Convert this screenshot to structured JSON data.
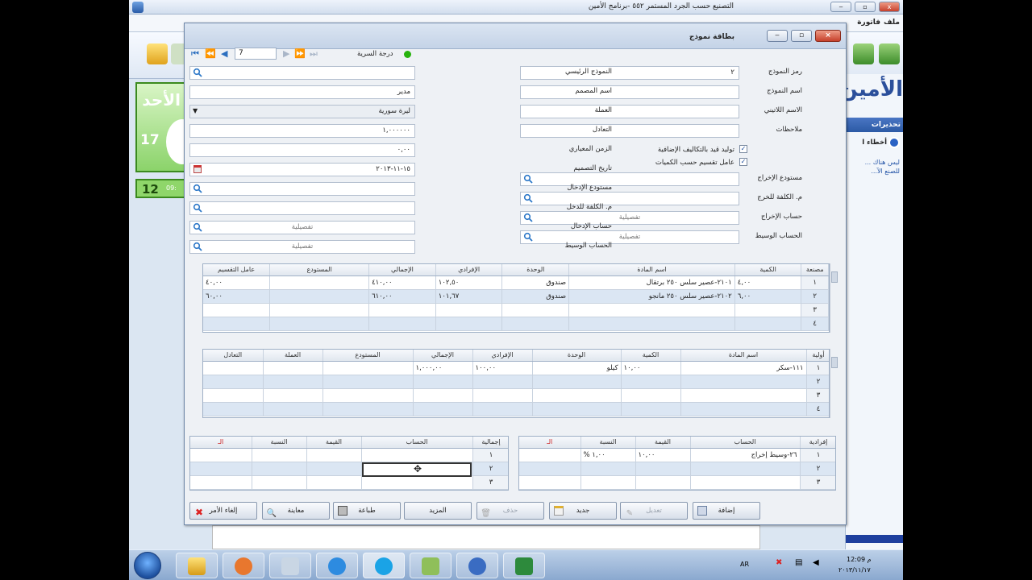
{
  "app": {
    "title": "التصنيع حسب الجرد المستمر ٥٥٢ -برنامج الأمين",
    "menu": [
      "ملف",
      "فاتورة"
    ]
  },
  "left_panel": {
    "day_label": "الأحد",
    "day_number": "17",
    "time_number": "12",
    "time_small": "09:"
  },
  "right_panel": {
    "logo": "الأمين",
    "header": "تحذيرات",
    "item": "أخطاء ا",
    "link_text": "ليس هناك ... للصنع الآ..."
  },
  "dialog": {
    "title": "بطاقة نموذج",
    "nav": {
      "record": "7"
    },
    "status_label": "درجة السرية",
    "fields": {
      "model_code_label": "رمز النموذج",
      "model_code": "٢",
      "model_name_label": "اسم النموذج",
      "model_name": "",
      "second_name_label": "الاسم اللاتيني",
      "second_name": "",
      "notes_label": "ملاحظات",
      "notes": "",
      "main_model_label": "النموذج الرئيسي",
      "main_model": "",
      "designer_label": "اسم المصمم",
      "designer": "مدير",
      "currency_label": "العملة",
      "currency": "ليرة سورية",
      "rate_label": "التعادل",
      "rate": "١,٠٠٠٠٠٠",
      "std_time_label": "الزمن المعياري",
      "std_time": "٠,٠٠",
      "design_date_label": "تاريخ التصميم",
      "design_date": "١٥-١١-٢٠١٣",
      "input_store_label": "مستودع الإدخال",
      "input_store": "",
      "input_cc_label": "م. الكلفة للدخل",
      "input_cc": "",
      "input_account_label": "حساب الإدخال",
      "input_account": "تفصيلية",
      "mid_account_label": "الحساب الوسيط",
      "mid_account": "تفصيلية",
      "output_store_label": "مستودع الإخراج",
      "output_store": "",
      "output_cc_label": "م. الكلفة للخرج",
      "output_cc": "",
      "output_account_label": "حساب الإخراج",
      "output_account": "تفصيلية",
      "mid_account2_label": "الحساب الوسيط",
      "mid_account2": "تفصيلية",
      "check1_label": "توليد قيد بالتكاليف الإضافية",
      "check2_label": "عامل تقسيم حسب الكميات"
    },
    "grid1": {
      "headers": [
        "مصنعة",
        "اسم المادة",
        "الكمية",
        "الوحدة",
        "الإفرادي",
        "الإجمالي",
        "المستودع",
        "عامل التقسيم"
      ],
      "rows": [
        [
          "١",
          "٢١٠١-عصير سلس ٢٥٠ برتقال",
          "٤,٠٠",
          "صندوق",
          "١٠٢,٥٠",
          "٤١٠,٠٠",
          "",
          "٤٠,٠٠"
        ],
        [
          "٢",
          "٢١٠٢-عصير سلس ٢٥٠ مانجو",
          "٦,٠٠",
          "صندوق",
          "١٠١,٦٧",
          "٦١٠,٠٠",
          "",
          "٦٠,٠٠"
        ],
        [
          "٣",
          "",
          "",
          "",
          "",
          "",
          "",
          ""
        ],
        [
          "٤",
          "",
          "",
          "",
          "",
          "",
          "",
          ""
        ]
      ]
    },
    "grid2": {
      "headers": [
        "أولية",
        "اسم المادة",
        "الكمية",
        "الوحدة",
        "الإفرادي",
        "الإجمالي",
        "المستودع",
        "العملة",
        "التعادل"
      ],
      "rows": [
        [
          "١",
          "١١١-سكر",
          "١٠,٠٠",
          "كيلو",
          "١٠٠,٠٠",
          "١,٠٠٠,٠٠",
          "",
          "",
          ""
        ],
        [
          "٢",
          "",
          "",
          "",
          "",
          "",
          "",
          "",
          ""
        ],
        [
          "٣",
          "",
          "",
          "",
          "",
          "",
          "",
          "",
          ""
        ],
        [
          "٤",
          "",
          "",
          "",
          "",
          "",
          "",
          "",
          ""
        ]
      ]
    },
    "grid3": {
      "headers": [
        "إفرادية",
        "الحساب",
        "القيمة",
        "النسبة",
        "الـ"
      ],
      "rows": [
        [
          "١",
          "٢٦-وسيط إخراج",
          "١٠,٠٠",
          "% ١,٠٠",
          ""
        ],
        [
          "٢",
          "",
          "",
          "",
          ""
        ],
        [
          "٣",
          "",
          "",
          "",
          ""
        ]
      ]
    },
    "grid4": {
      "headers": [
        "إجمالية",
        "الحساب",
        "القيمة",
        "النسبة",
        "الـ"
      ],
      "rows": [
        [
          "١",
          "",
          "",
          "",
          ""
        ],
        [
          "٢",
          "",
          "",
          "",
          ""
        ],
        [
          "٣",
          "",
          "",
          "",
          ""
        ]
      ]
    },
    "buttons": {
      "add": "إضافة",
      "edit": "تعديل",
      "new": "جديد",
      "delete": "حذف",
      "more": "المزيد",
      "print": "طباعة",
      "preview": "معاينة",
      "cancel": "إلغاء الأمر"
    }
  },
  "taskbar": {
    "lang": "AR",
    "time": "12:09 م",
    "date": "٢٠١٣/١١/١٧"
  },
  "colors": {
    "accent": "#2c5aa5",
    "grid_alt": "#dbe6f3",
    "status_green": "#27b30e",
    "close_red": "#c6402b"
  }
}
